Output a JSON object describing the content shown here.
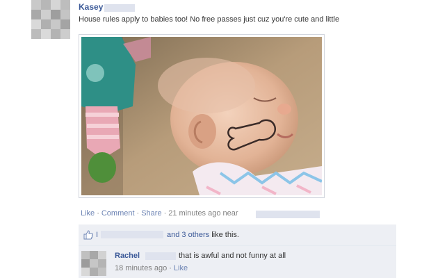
{
  "post": {
    "author": "Kasey",
    "text": "House rules apply to babies too! No free passes just cuz you're cute and little",
    "actions": {
      "like": "Like",
      "comment": "Comment",
      "share": "Share",
      "time": "21 minutes ago near",
      "separator": "·"
    }
  },
  "likes": {
    "liker_initial": "I",
    "text": "and 3 others",
    "suffix": "like this."
  },
  "comment": {
    "author": "Rachel",
    "text": "that is awful and not funny at all",
    "time": "18 minutes ago",
    "like": "Like",
    "separator": "·"
  },
  "colors": {
    "link_blue": "#3b5998",
    "light_link": "#6d84b4",
    "box_bg": "#edeff4",
    "redaction": "#dfe3ee"
  },
  "icons": {
    "like": "thumbs-up-icon"
  }
}
